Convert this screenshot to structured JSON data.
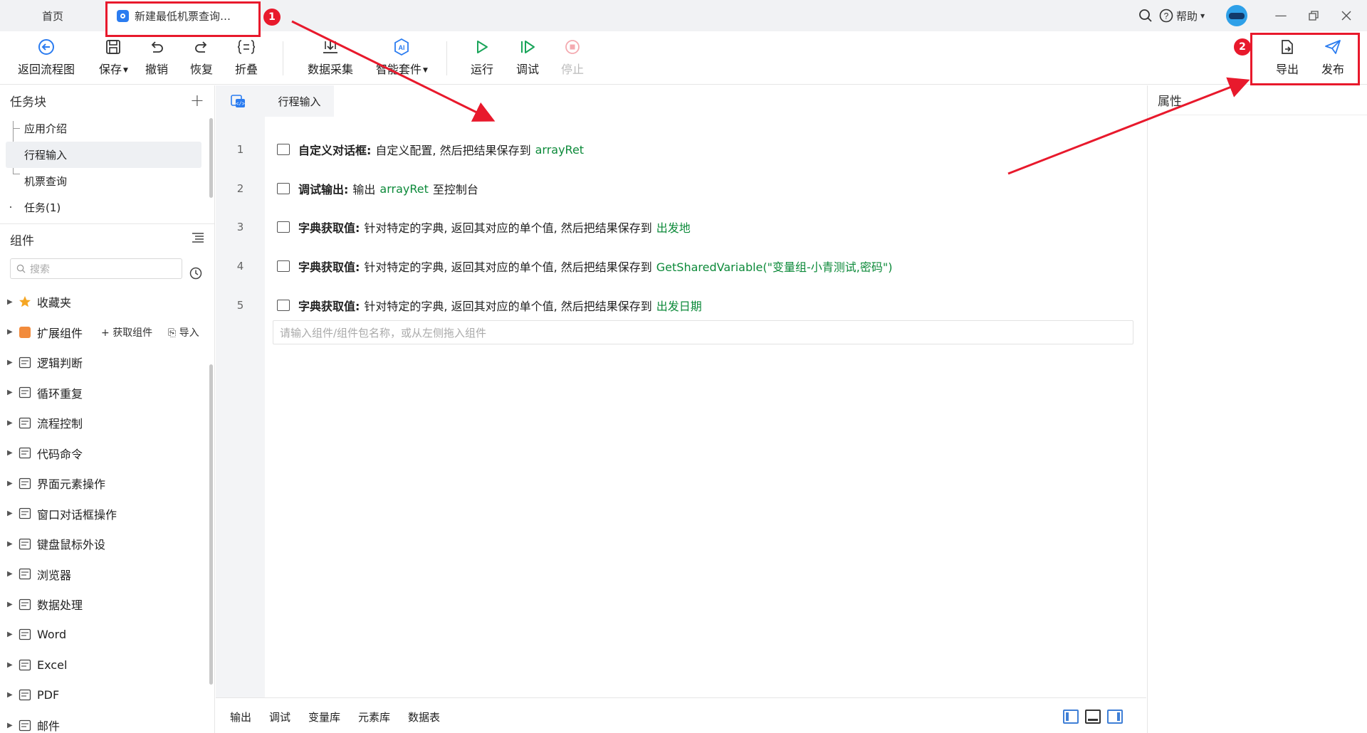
{
  "titlebar": {
    "home_tab": "首页",
    "active_tab": "新建最低机票查询…",
    "help_label": "帮助"
  },
  "toolbar": {
    "back": "返回流程图",
    "save": "保存",
    "undo": "撤销",
    "redo": "恢复",
    "fold": "折叠",
    "data_collect": "数据采集",
    "smart_kit": "智能套件",
    "run": "运行",
    "debug": "调试",
    "stop": "停止",
    "export": "导出",
    "publish": "发布"
  },
  "task_panel": {
    "title": "任务块",
    "items": [
      "应用介绍",
      "行程输入",
      "机票查询"
    ],
    "task_group": "任务(1)"
  },
  "component_panel": {
    "title": "组件",
    "search_placeholder": "搜索",
    "get_component": "获取组件",
    "import": "导入",
    "items": [
      "收藏夹",
      "扩展组件",
      "逻辑判断",
      "循环重复",
      "流程控制",
      "代码命令",
      "界面元素操作",
      "窗口对话框操作",
      "键盘鼠标外设",
      "浏览器",
      "数据处理",
      "Word",
      "Excel",
      "PDF",
      "邮件"
    ]
  },
  "editor": {
    "tab": "行程输入",
    "lines": [
      {
        "no": "1",
        "name": "自定义对话框:",
        "desc": "自定义配置, 然后把结果保存到",
        "var": "arrayRet",
        "tail": ""
      },
      {
        "no": "2",
        "name": "调试输出:",
        "desc": "输出",
        "var": "arrayRet",
        "tail": "至控制台"
      },
      {
        "no": "3",
        "name": "字典获取值:",
        "desc": "针对特定的字典, 返回其对应的单个值, 然后把结果保存到",
        "var": "出发地",
        "tail": ""
      },
      {
        "no": "4",
        "name": "字典获取值:",
        "desc": "针对特定的字典, 返回其对应的单个值, 然后把结果保存到",
        "var": "GetSharedVariable(\"变量组-小青测试,密码\")",
        "tail": ""
      },
      {
        "no": "5",
        "name": "字典获取值:",
        "desc": "针对特定的字典, 返回其对应的单个值, 然后把结果保存到",
        "var": "出发日期",
        "tail": ""
      }
    ],
    "input_placeholder": "请输入组件/组件包名称，或从左侧拖入组件"
  },
  "bottom_tabs": [
    "输出",
    "调试",
    "变量库",
    "元素库",
    "数据表"
  ],
  "properties_panel": {
    "title": "属性"
  },
  "annotations": {
    "badge1": "1",
    "badge2": "2"
  },
  "colors": {
    "accent": "#2b7cf0",
    "variable": "#0d8a3a",
    "annotation": "#e8192c",
    "run": "#1aa55a"
  }
}
